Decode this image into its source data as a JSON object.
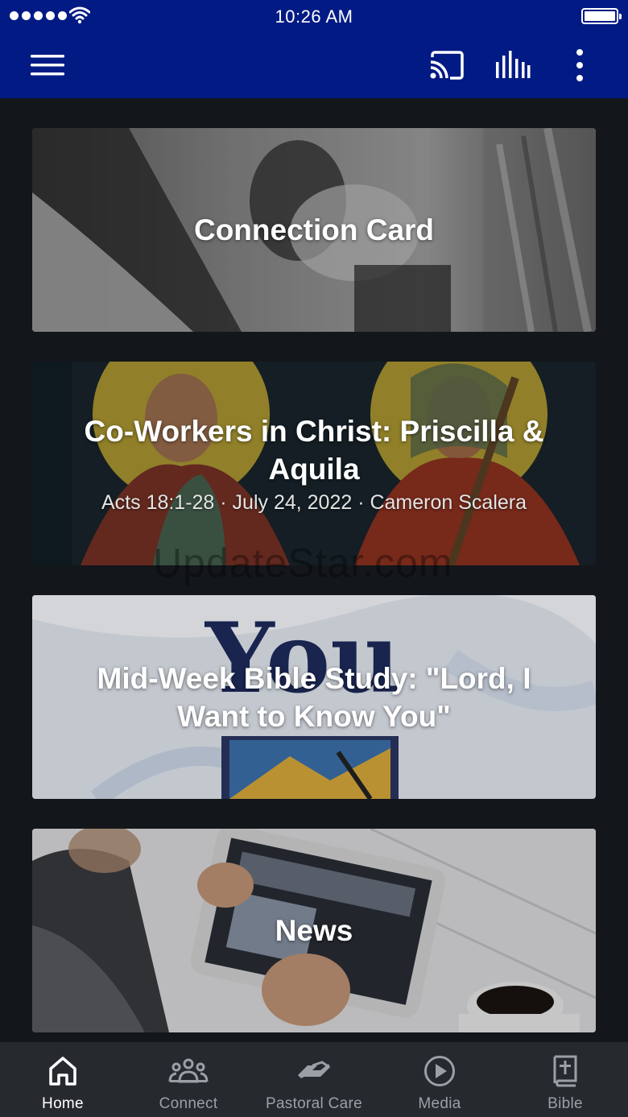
{
  "status_bar": {
    "time": "10:26 AM"
  },
  "app_bar": {
    "menu_icon": "hamburger-menu-icon",
    "cast_icon": "cast-icon",
    "audio_icon": "audio-bars-icon",
    "more_icon": "more-vertical-icon",
    "background_color": "#021b84"
  },
  "cards": [
    {
      "title": "Connection Card",
      "subtitle": ""
    },
    {
      "title": "Co-Workers in Christ: Priscilla & Aquila",
      "subtitle": "Acts 18:1-28 · July 24, 2022 · Cameron Scalera"
    },
    {
      "title": "Mid-Week Bible Study: \"Lord, I Want to Know You\"",
      "subtitle": ""
    },
    {
      "title": "News",
      "subtitle": ""
    }
  ],
  "watermark": "UpdateStar.com",
  "tabs": [
    {
      "label": "Home",
      "icon": "home-icon",
      "active": true
    },
    {
      "label": "Connect",
      "icon": "people-group-icon",
      "active": false
    },
    {
      "label": "Pastoral Care",
      "icon": "handshake-icon",
      "active": false
    },
    {
      "label": "Media",
      "icon": "play-circle-icon",
      "active": false
    },
    {
      "label": "Bible",
      "icon": "bible-icon",
      "active": false
    }
  ]
}
